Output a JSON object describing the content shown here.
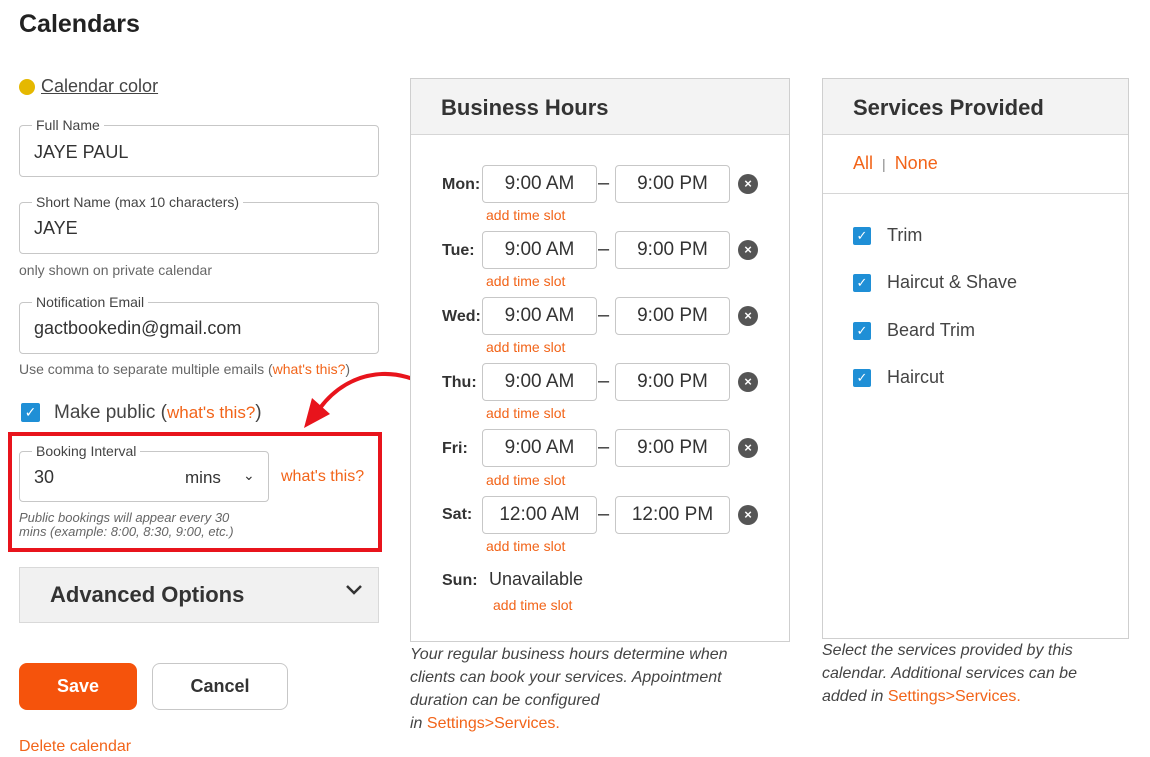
{
  "page": {
    "title": "Calendars"
  },
  "calendar_color": {
    "label": "Calendar color",
    "color": "#e5b800"
  },
  "full_name": {
    "legend": "Full Name",
    "value": "JAYE PAUL"
  },
  "short_name": {
    "legend": "Short Name (max 10 characters)",
    "value": "JAYE",
    "hint": "only shown on private calendar"
  },
  "notification_email": {
    "legend": "Notification Email",
    "value": "gactbookedin@gmail.com",
    "hint": "Use comma to separate multiple emails (",
    "hint_link": "what's this?",
    "hint_end": ")"
  },
  "make_public": {
    "label": "Make public (",
    "link": "what's this?",
    "end": ")",
    "checked": true
  },
  "booking_interval": {
    "legend": "Booking Interval",
    "value": "30",
    "unit": "mins",
    "help_link": "what's this?",
    "hint_line1": "Public bookings will appear every 30",
    "hint_line2": "mins (example: 8:00, 8:30, 9:00, etc.)"
  },
  "advanced": {
    "label": "Advanced Options"
  },
  "buttons": {
    "save": "Save",
    "cancel": "Cancel",
    "delete": "Delete calendar"
  },
  "business_hours": {
    "title": "Business Hours",
    "add_slot_label": "add time slot",
    "days": [
      {
        "label": "Mon:",
        "start": "9:00 AM",
        "end": "9:00 PM"
      },
      {
        "label": "Tue:",
        "start": "9:00 AM",
        "end": "9:00 PM"
      },
      {
        "label": "Wed:",
        "start": "9:00 AM",
        "end": "9:00 PM"
      },
      {
        "label": "Thu:",
        "start": "9:00 AM",
        "end": "9:00 PM"
      },
      {
        "label": "Fri:",
        "start": "9:00 AM",
        "end": "9:00 PM"
      },
      {
        "label": "Sat:",
        "start": "12:00 AM",
        "end": "12:00 PM"
      }
    ],
    "sunday": {
      "label": "Sun:",
      "status": "Unavailable"
    },
    "caption_line1": "Your regular business hours determine when",
    "caption_line2": "clients can book your services. Appointment",
    "caption_line3": "duration can be configured",
    "caption_line4_prefix": "in ",
    "caption_link": "Settings>Services."
  },
  "services": {
    "title": "Services Provided",
    "all": "All",
    "separator": "|",
    "none": "None",
    "items": [
      {
        "label": "Trim",
        "checked": true
      },
      {
        "label": "Haircut & Shave",
        "checked": true
      },
      {
        "label": "Beard Trim",
        "checked": true
      },
      {
        "label": "Haircut",
        "checked": true
      }
    ],
    "caption_line1": "Select the services provided by this",
    "caption_line2": "calendar. Additional services can be",
    "caption_line3_prefix": "added in ",
    "caption_link": "Settings>Services."
  },
  "colors": {
    "accent": "#f26419",
    "save": "#f5530c",
    "annotation": "#e8141c",
    "checkbox": "#1f8fd6"
  }
}
